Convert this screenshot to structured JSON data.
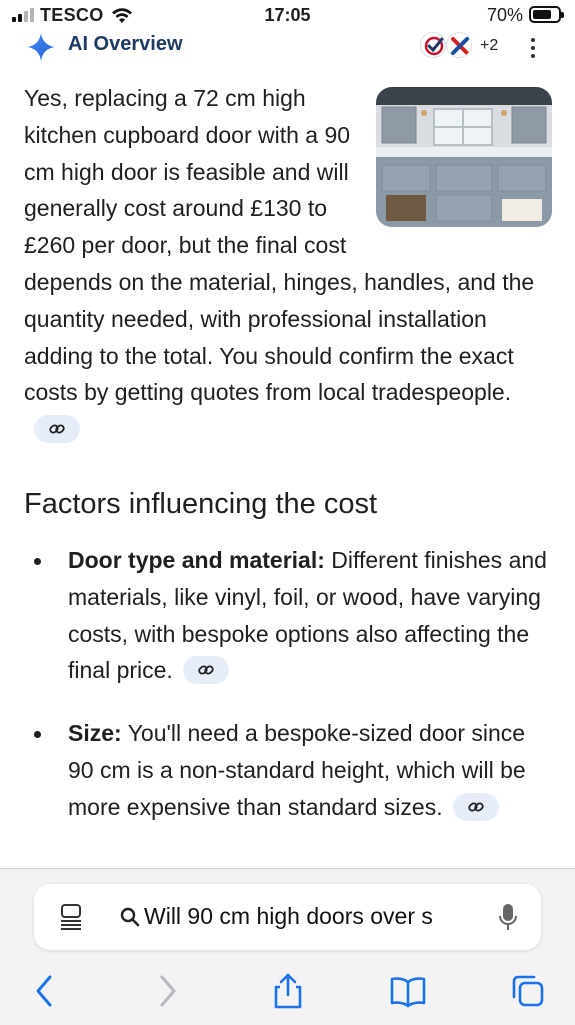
{
  "status_bar": {
    "carrier": "TESCO",
    "time": "17:05",
    "battery_percent": "70%",
    "battery_level": 0.7,
    "signal_bars_active": 2,
    "signal_bars_total": 4
  },
  "ai_overview": {
    "title": "AI Overview",
    "sources_more": "+2",
    "intro_text": "Yes, replacing a 72 cm high kitchen cupboard door with a 90 cm high door is feasible and will generally cost around £130 to £260 per door, but the final cost depends on the material, hinges, handles, and the quantity needed, with profes­sional installation adding to the total. You should confirm the exact costs by getting quotes from local tradespeople.",
    "section_heading": "Factors influencing the cost",
    "bullets": [
      {
        "label": "Door type and material",
        "text": "Different finishes and materials, like vinyl, foil, or wood, have varying costs, with bespoke options also affecting the final price."
      },
      {
        "label": "Size",
        "text": "You'll need a bespoke-sized door since 90 cm is a non-standard height, which will be more expensive than standard sizes."
      }
    ]
  },
  "browser": {
    "search_query": "Will 90 cm high doors over s",
    "icons": [
      "tab-overview-icon",
      "search-icon",
      "microphone-icon",
      "back-icon",
      "forward-icon",
      "share-icon",
      "bookmarks-icon",
      "tabs-icon"
    ]
  },
  "colors": {
    "accent_blue": "#1a73e8",
    "title_navy": "#1f3b63",
    "cite_chip": "#e7edf8",
    "toolbar_bg": "#f3f3f5"
  }
}
